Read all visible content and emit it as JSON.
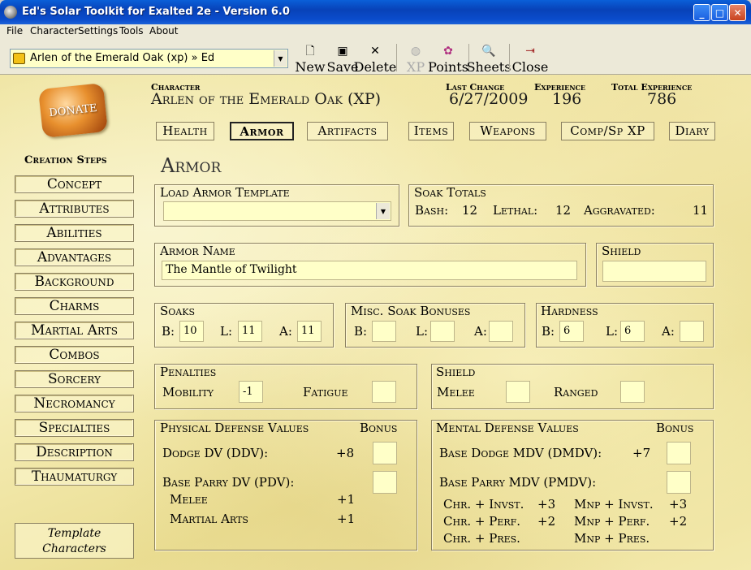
{
  "window": {
    "title": "Ed's Solar Toolkit for Exalted 2e - Version 6.0",
    "min": "_",
    "max": "□",
    "close": "✕"
  },
  "menu": [
    "File",
    "Character",
    "Settings",
    "Tools",
    "About"
  ],
  "toolbar": {
    "character_select": "Arlen of the Emerald Oak (xp) » Ed",
    "buttons": {
      "new": "New",
      "save": "Save",
      "delete": "Delete",
      "xp": "XP",
      "points": "Points",
      "sheets": "Sheets",
      "close": "Close"
    }
  },
  "sidebar": {
    "donate": "DONATE",
    "creation_steps_title": "Creation Steps",
    "steps": [
      "Concept",
      "Attributes",
      "Abilities",
      "Advantages",
      "Background",
      "Charms",
      "Martial Arts",
      "Combos",
      "Sorcery",
      "Necromancy",
      "Specialties",
      "Description",
      "Thaumaturgy"
    ],
    "template_line1": "Template",
    "template_line2": "Characters"
  },
  "header": {
    "character_label": "Character",
    "character_value": "Arlen of the Emerald Oak (XP)",
    "last_change_label": "Last Change",
    "last_change_value": "6/27/2009",
    "experience_label": "Experience",
    "experience_value": "196",
    "total_experience_label": "Total Experience",
    "total_experience_value": "786"
  },
  "tabs": [
    "Health",
    "Armor",
    "Artifacts",
    "Items",
    "Weapons",
    "Comp/Sp XP",
    "Diary"
  ],
  "section_title": "Armor",
  "load_template": {
    "label": "Load Armor Template",
    "value": ""
  },
  "soak_totals": {
    "label": "Soak Totals",
    "bash_label": "Bash:",
    "bash": "12",
    "lethal_label": "Lethal:",
    "lethal": "12",
    "aggravated_label": "Aggravated:",
    "aggravated": "11"
  },
  "armor_name": {
    "label": "Armor Name",
    "value": "The Mantle of Twilight"
  },
  "shield_name": {
    "label": "Shield",
    "value": ""
  },
  "soaks": {
    "label": "Soaks",
    "b_label": "B:",
    "b": "10",
    "l_label": "L:",
    "l": "11",
    "a_label": "A:",
    "a": "11"
  },
  "misc_soak": {
    "label": "Misc. Soak Bonuses",
    "b_label": "B:",
    "b": "",
    "l_label": "L:",
    "l": "",
    "a_label": "A:",
    "a": ""
  },
  "hardness": {
    "label": "Hardness",
    "b_label": "B:",
    "b": "6",
    "l_label": "L:",
    "l": "6",
    "a_label": "A:",
    "a": ""
  },
  "penalties": {
    "label": "Penalties",
    "mobility_label": "Mobility",
    "mobility": "-1",
    "fatigue_label": "Fatigue",
    "fatigue": ""
  },
  "shield_box": {
    "label": "Shield",
    "melee_label": "Melee",
    "melee": "",
    "ranged_label": "Ranged",
    "ranged": ""
  },
  "physical_dv": {
    "label": "Physical Defense Values",
    "bonus_label": "Bonus",
    "dodge_label": "Dodge DV (DDV):",
    "dodge": "+8",
    "dodge_bonus": "",
    "parry_label": "Base Parry DV (PDV):",
    "parry_bonus": "",
    "melee_label": "Melee",
    "melee": "+1",
    "martial_label": "Martial Arts",
    "martial": "+1"
  },
  "mental_dv": {
    "label": "Mental Defense Values",
    "bonus_label": "Bonus",
    "dodge_label": "Base Dodge MDV (DMDV):",
    "dodge": "+7",
    "dodge_bonus": "",
    "parry_label": "Base Parry MDV (PMDV):",
    "parry_bonus": "",
    "rows": [
      {
        "l": "Chr. + Invst.",
        "lv": "+3",
        "r": "Mnp + Invst.",
        "rv": "+3"
      },
      {
        "l": "Chr. + Perf.",
        "lv": "+2",
        "r": "Mnp + Perf.",
        "rv": "+2"
      },
      {
        "l": "Chr. + Pres.",
        "lv": "",
        "r": "Mnp + Pres.",
        "rv": ""
      }
    ]
  }
}
